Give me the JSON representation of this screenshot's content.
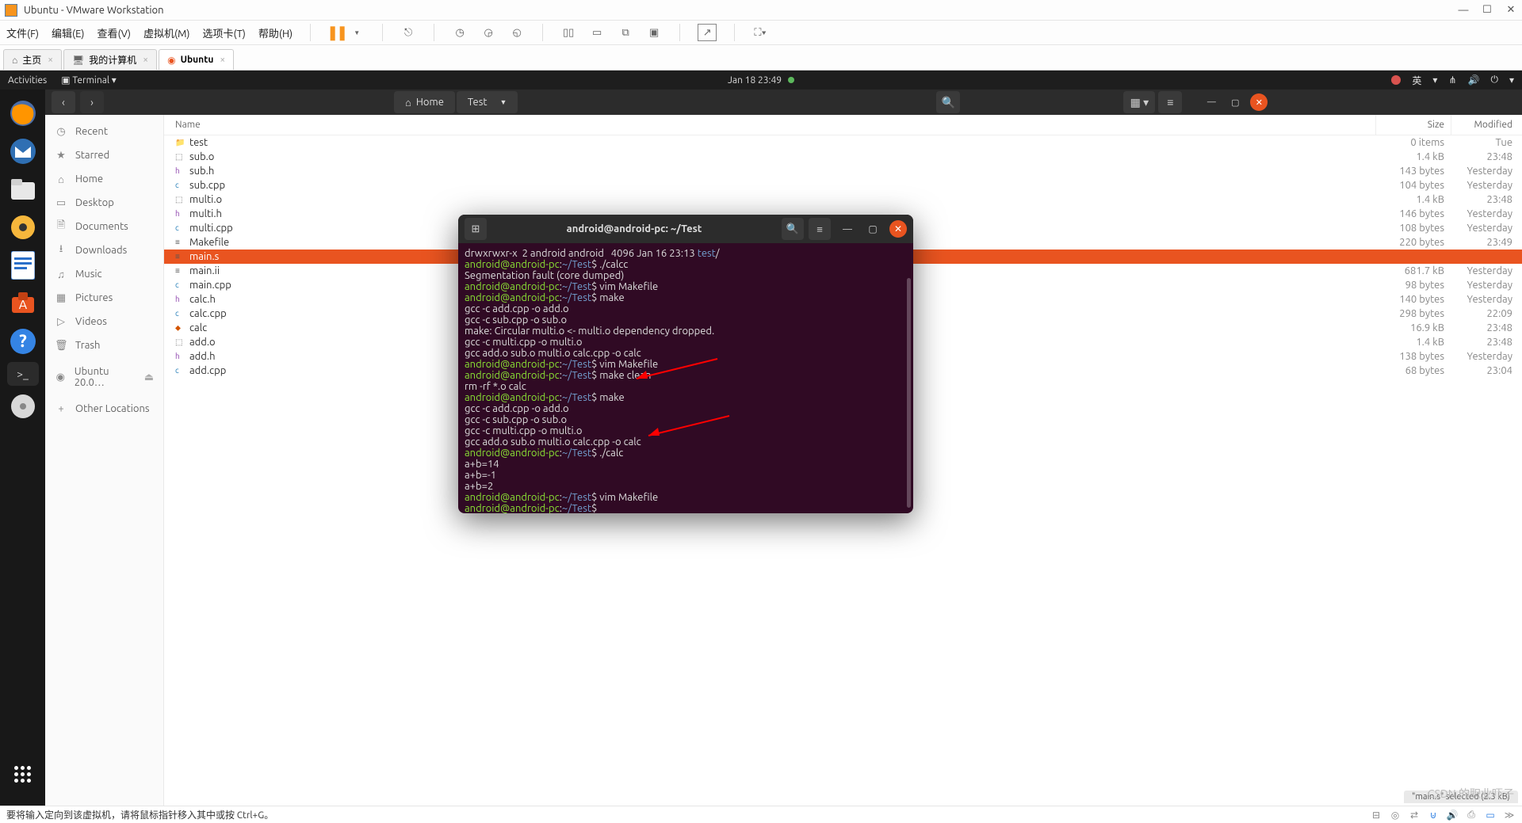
{
  "vmware": {
    "title": "Ubuntu - VMware Workstation",
    "menu": [
      "文件(F)",
      "编辑(E)",
      "查看(V)",
      "虚拟机(M)",
      "选项卡(T)",
      "帮助(H)"
    ],
    "tabs": [
      {
        "label": "主页",
        "icon": "home"
      },
      {
        "label": "我的计算机",
        "icon": "computer"
      },
      {
        "label": "Ubuntu",
        "icon": "ubuntu",
        "active": true
      }
    ],
    "status": "要将输入定向到该虚拟机，请将鼠标指针移入其中或按 Ctrl+G。"
  },
  "gnome": {
    "activities": "Activities",
    "app": "Terminal",
    "clock": "Jan 18  23:49",
    "ime": "英"
  },
  "dock": {
    "items": [
      "firefox",
      "thunderbird",
      "files",
      "rhythmbox",
      "libreoffice",
      "software",
      "help",
      "terminal",
      "dvd"
    ]
  },
  "nautilus": {
    "path": [
      "Home",
      "Test"
    ],
    "sidebar": [
      {
        "icon": "clock",
        "label": "Recent"
      },
      {
        "icon": "star",
        "label": "Starred"
      },
      {
        "icon": "home",
        "label": "Home"
      },
      {
        "icon": "desk",
        "label": "Desktop"
      },
      {
        "icon": "doc",
        "label": "Documents"
      },
      {
        "icon": "down",
        "label": "Downloads"
      },
      {
        "icon": "music",
        "label": "Music"
      },
      {
        "icon": "pic",
        "label": "Pictures"
      },
      {
        "icon": "vid",
        "label": "Videos"
      },
      {
        "icon": "trash",
        "label": "Trash"
      },
      {
        "icon": "disk",
        "label": "Ubuntu 20.0…"
      },
      {
        "icon": "plus",
        "label": "Other Locations"
      }
    ],
    "columns": {
      "name": "Name",
      "size": "Size",
      "modified": "Modified"
    },
    "files": [
      {
        "icon": "folder",
        "name": "test",
        "size": "0 items",
        "mod": "Tue"
      },
      {
        "icon": "obj",
        "name": "sub.o",
        "size": "1.4 kB",
        "mod": "23:48"
      },
      {
        "icon": "h",
        "name": "sub.h",
        "size": "143 bytes",
        "mod": "Yesterday"
      },
      {
        "icon": "cpp",
        "name": "sub.cpp",
        "size": "104 bytes",
        "mod": "Yesterday"
      },
      {
        "icon": "obj",
        "name": "multi.o",
        "size": "1.4 kB",
        "mod": "23:48"
      },
      {
        "icon": "h",
        "name": "multi.h",
        "size": "146 bytes",
        "mod": "Yesterday"
      },
      {
        "icon": "cpp",
        "name": "multi.cpp",
        "size": "108 bytes",
        "mod": "Yesterday"
      },
      {
        "icon": "txt",
        "name": "Makefile",
        "size": "220 bytes",
        "mod": "23:49"
      },
      {
        "icon": "txt",
        "name": "main.s",
        "size": "",
        "mod": "",
        "selected": true
      },
      {
        "icon": "txt",
        "name": "main.ii",
        "size": "681.7 kB",
        "mod": "Yesterday"
      },
      {
        "icon": "cpp",
        "name": "main.cpp",
        "size": "98 bytes",
        "mod": "Yesterday"
      },
      {
        "icon": "h",
        "name": "calc.h",
        "size": "140 bytes",
        "mod": "Yesterday"
      },
      {
        "icon": "cpp",
        "name": "calc.cpp",
        "size": "298 bytes",
        "mod": "22:09"
      },
      {
        "icon": "bin",
        "name": "calc",
        "size": "16.9 kB",
        "mod": "23:48"
      },
      {
        "icon": "obj",
        "name": "add.o",
        "size": "1.4 kB",
        "mod": "23:48"
      },
      {
        "icon": "h",
        "name": "add.h",
        "size": "138 bytes",
        "mod": "Yesterday"
      },
      {
        "icon": "cpp",
        "name": "add.cpp",
        "size": "68 bytes",
        "mod": "23:04"
      }
    ],
    "status": "\"main.s\" selected  (2.3 kB)"
  },
  "terminal": {
    "title": "android@android-pc: ~/Test",
    "lines": [
      [
        {
          "c": "tw",
          "t": "drwxrwxr-x  2 android android   4096 Jan 16 23:13 "
        },
        {
          "c": "tb",
          "t": "test"
        },
        {
          "c": "tw",
          "t": "/"
        }
      ],
      [
        {
          "c": "tg",
          "t": "android@android-pc"
        },
        {
          "c": "tw",
          "t": ":"
        },
        {
          "c": "tb",
          "t": "~/Test"
        },
        {
          "c": "tw",
          "t": "$ ./calcc"
        }
      ],
      [
        {
          "c": "tw",
          "t": "Segmentation fault (core dumped)"
        }
      ],
      [
        {
          "c": "tg",
          "t": "android@android-pc"
        },
        {
          "c": "tw",
          "t": ":"
        },
        {
          "c": "tb",
          "t": "~/Test"
        },
        {
          "c": "tw",
          "t": "$ vim Makefile"
        }
      ],
      [
        {
          "c": "tg",
          "t": "android@android-pc"
        },
        {
          "c": "tw",
          "t": ":"
        },
        {
          "c": "tb",
          "t": "~/Test"
        },
        {
          "c": "tw",
          "t": "$ make"
        }
      ],
      [
        {
          "c": "tw",
          "t": "gcc -c add.cpp -o add.o"
        }
      ],
      [
        {
          "c": "tw",
          "t": "gcc -c sub.cpp -o sub.o"
        }
      ],
      [
        {
          "c": "tw",
          "t": "make: Circular multi.o <- multi.o dependency dropped."
        }
      ],
      [
        {
          "c": "tw",
          "t": "gcc -c multi.cpp -o multi.o"
        }
      ],
      [
        {
          "c": "tw",
          "t": "gcc add.o sub.o multi.o calc.cpp -o calc"
        }
      ],
      [
        {
          "c": "tg",
          "t": "android@android-pc"
        },
        {
          "c": "tw",
          "t": ":"
        },
        {
          "c": "tb",
          "t": "~/Test"
        },
        {
          "c": "tw",
          "t": "$ vim Makefile"
        }
      ],
      [
        {
          "c": "tg",
          "t": "android@android-pc"
        },
        {
          "c": "tw",
          "t": ":"
        },
        {
          "c": "tb",
          "t": "~/Test"
        },
        {
          "c": "tw",
          "t": "$ make clean"
        }
      ],
      [
        {
          "c": "tw",
          "t": "rm -rf *.o calc"
        }
      ],
      [
        {
          "c": "tg",
          "t": "android@android-pc"
        },
        {
          "c": "tw",
          "t": ":"
        },
        {
          "c": "tb",
          "t": "~/Test"
        },
        {
          "c": "tw",
          "t": "$ make"
        }
      ],
      [
        {
          "c": "tw",
          "t": "gcc -c add.cpp -o add.o"
        }
      ],
      [
        {
          "c": "tw",
          "t": "gcc -c sub.cpp -o sub.o"
        }
      ],
      [
        {
          "c": "tw",
          "t": "gcc -c multi.cpp -o multi.o"
        }
      ],
      [
        {
          "c": "tw",
          "t": "gcc add.o sub.o multi.o calc.cpp -o calc"
        }
      ],
      [
        {
          "c": "tg",
          "t": "android@android-pc"
        },
        {
          "c": "tw",
          "t": ":"
        },
        {
          "c": "tb",
          "t": "~/Test"
        },
        {
          "c": "tw",
          "t": "$ ./calc"
        }
      ],
      [
        {
          "c": "tw",
          "t": "a+b=14"
        }
      ],
      [
        {
          "c": "tw",
          "t": "a+b=-1"
        }
      ],
      [
        {
          "c": "tw",
          "t": "a+b=2"
        }
      ],
      [
        {
          "c": "tg",
          "t": "android@android-pc"
        },
        {
          "c": "tw",
          "t": ":"
        },
        {
          "c": "tb",
          "t": "~/Test"
        },
        {
          "c": "tw",
          "t": "$ vim Makefile"
        }
      ],
      [
        {
          "c": "tg",
          "t": "android@android-pc"
        },
        {
          "c": "tw",
          "t": ":"
        },
        {
          "c": "tb",
          "t": "~/Test"
        },
        {
          "c": "tw",
          "t": "$ "
        }
      ]
    ]
  },
  "watermark": "CSDN 的职业吓子"
}
